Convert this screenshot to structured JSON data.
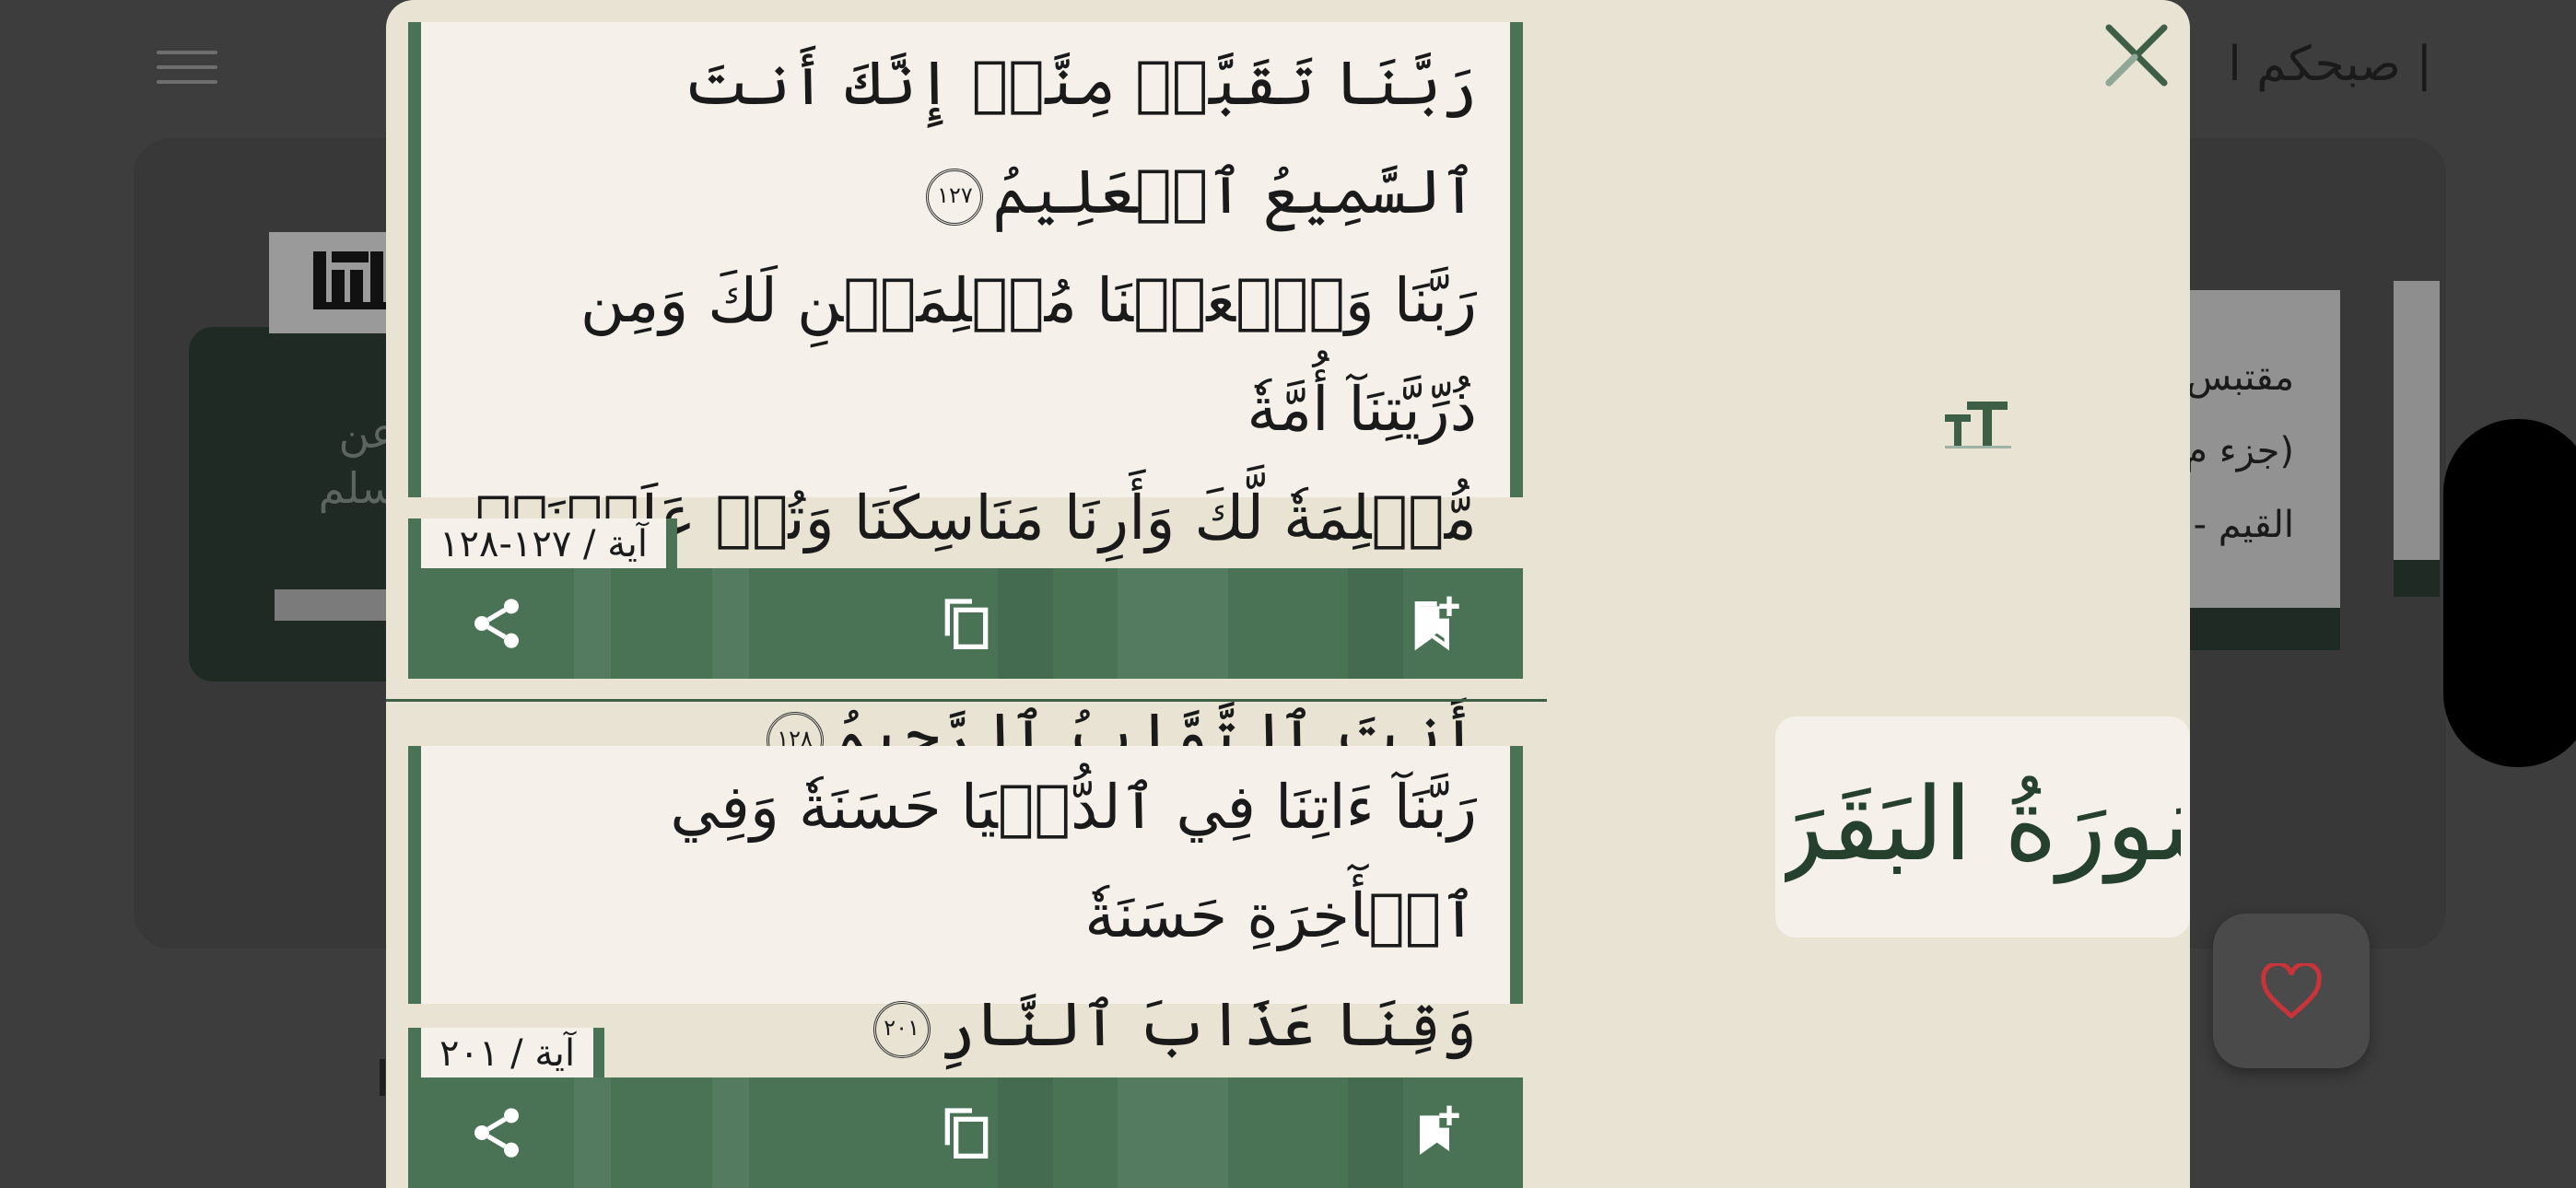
{
  "background": {
    "greeting": "| صبحكم ا",
    "left_card_text": "عن\nسلم",
    "right_card_lines": [
      "مقتبس",
      "(جزء م",
      "القيم -"
    ],
    "favorite_color": "#c8343a"
  },
  "modal": {
    "surah_name": "سُورَةُ البَقَرَة",
    "accent_color": "#4a7356",
    "verses": [
      {
        "lines": [
          "رَبَّنَا تَقَبَّلۡ مِنَّآۖ إِنَّكَ أَنتَ ٱلسَّمِيعُ ٱلۡعَلِيمُ",
          "رَبَّنَا وَٱجۡعَلۡنَا مُسۡلِمَيۡنِ لَكَ وَمِن ذُرِّيَّتِنَآ أُمَّةٗ",
          "مُّسۡلِمَةٗ لَّكَ وَأَرِنَا مَنَاسِكَنَا وَتُبۡ عَلَيۡنَآۖ إِنَّكَ",
          "أَنتَ ٱلتَّوَّابُ ٱلرَّحِيمُ"
        ],
        "marker_1": "١٢٧",
        "marker_2": "١٢٨",
        "ayah_label": "آية / ١٢٧-١٢٨"
      },
      {
        "lines": [
          "رَبَّنَآ ءَاتِنَا فِي ٱلدُّنۡيَا حَسَنَةٗ وَفِي ٱلۡأٓخِرَةِ حَسَنَةٗ",
          "وَقِنَا عَذَابَ ٱلنَّارِ"
        ],
        "marker_1": "٢٠١",
        "ayah_label": "آية / ٢٠١"
      }
    ],
    "actions": {
      "share": "share-icon",
      "copy": "copy-icon",
      "bookmark": "bookmark-add-icon",
      "close": "close-icon",
      "text_size": "text-size-icon"
    }
  }
}
